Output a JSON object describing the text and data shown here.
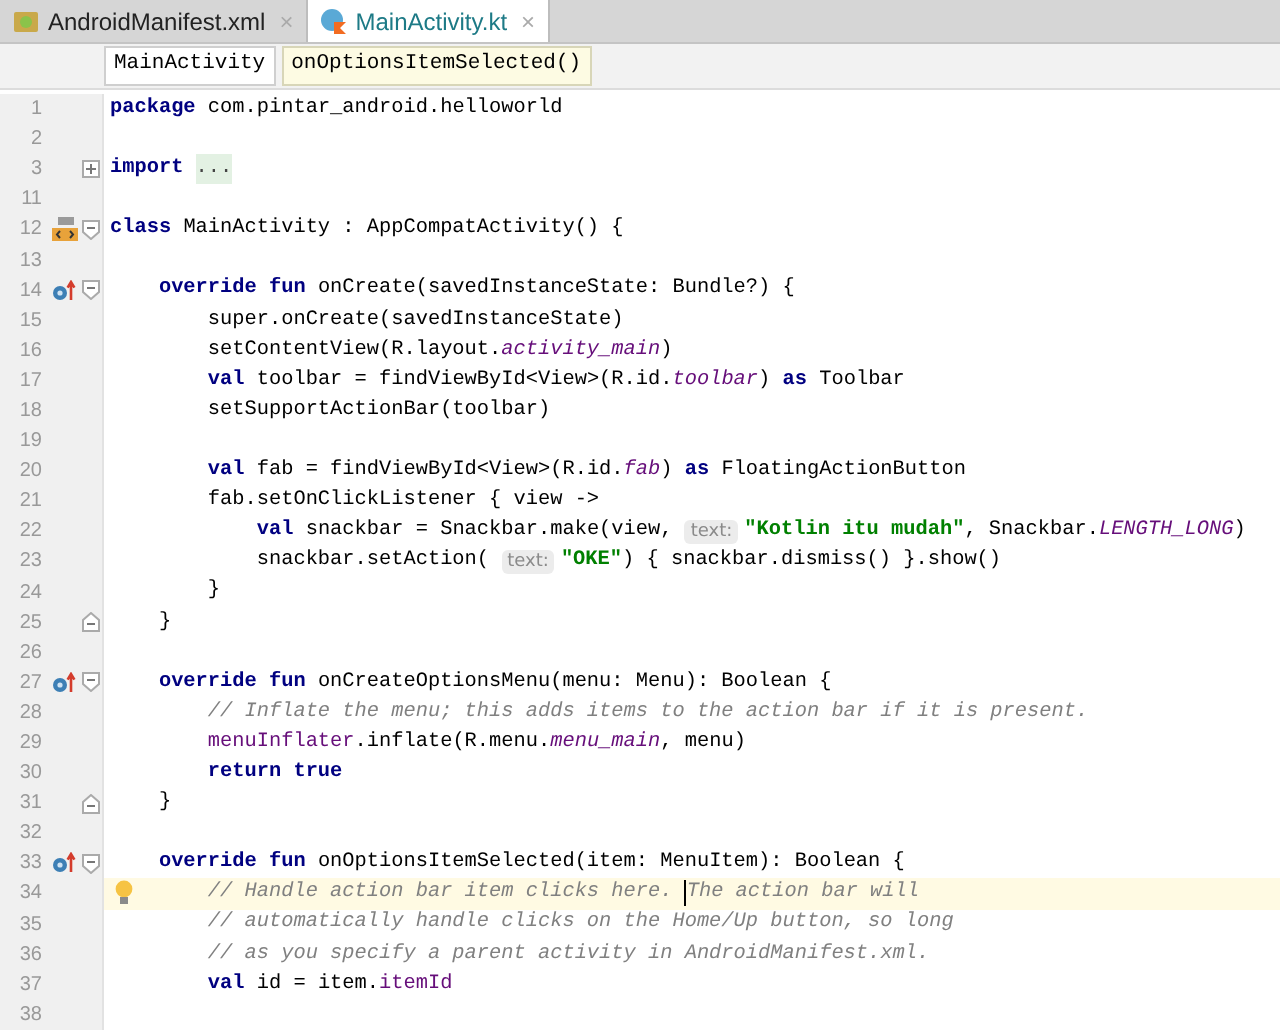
{
  "tabs": [
    {
      "label": "AndroidManifest.xml",
      "kind": "xml",
      "selected": false,
      "close": "×"
    },
    {
      "label": "MainActivity.kt",
      "kind": "kotlin",
      "selected": true,
      "close": "×"
    }
  ],
  "breadcrumbs": [
    {
      "label": "MainActivity",
      "selected": false
    },
    {
      "label": "onOptionsItemSelected()",
      "selected": true
    }
  ],
  "lines": [
    {
      "number": "1",
      "current": false,
      "tokens": [
        {
          "kind": "keyword",
          "text": "package "
        },
        {
          "kind": "plain",
          "text": "com.pintar_android.helloworld"
        }
      ]
    },
    {
      "number": "2",
      "current": false
    },
    {
      "number": "3",
      "current": false,
      "fold": {
        "kind": "collapsed"
      },
      "tokens": [
        {
          "kind": "keyword",
          "text": "import "
        },
        {
          "kind": "folded",
          "text": "..."
        }
      ]
    },
    {
      "number": "11",
      "current": false
    },
    {
      "number": "12",
      "current": false,
      "marker": {
        "kind": "class"
      },
      "fold": {
        "kind": "start"
      },
      "tokens": [
        {
          "kind": "keyword",
          "text": "class "
        },
        {
          "kind": "plain",
          "text": "MainActivity : AppCompatActivity() {"
        }
      ]
    },
    {
      "number": "13",
      "current": false
    },
    {
      "number": "14",
      "current": false,
      "marker": {
        "kind": "override"
      },
      "fold": {
        "kind": "start"
      },
      "tokens": [
        {
          "kind": "keyword",
          "text": "    override fun "
        },
        {
          "kind": "plain",
          "text": "onCreate(savedInstanceState: Bundle?) {"
        }
      ]
    },
    {
      "number": "15",
      "current": false,
      "tokens": [
        {
          "kind": "plain",
          "text": "        super.onCreate(savedInstanceState)"
        }
      ]
    },
    {
      "number": "16",
      "current": false,
      "tokens": [
        {
          "kind": "plain",
          "text": "        setContentView(R.layout."
        },
        {
          "kind": "property-italic",
          "text": "activity_main"
        },
        {
          "kind": "plain",
          "text": ")"
        }
      ]
    },
    {
      "number": "17",
      "current": false,
      "tokens": [
        {
          "kind": "keyword",
          "text": "        val "
        },
        {
          "kind": "plain",
          "text": "toolbar = findViewById<View>(R.id."
        },
        {
          "kind": "property-italic",
          "text": "toolbar"
        },
        {
          "kind": "plain",
          "text": ") "
        },
        {
          "kind": "keyword",
          "text": "as "
        },
        {
          "kind": "plain",
          "text": "Toolbar"
        }
      ]
    },
    {
      "number": "18",
      "current": false,
      "tokens": [
        {
          "kind": "plain",
          "text": "        setSupportActionBar(toolbar)"
        }
      ]
    },
    {
      "number": "19",
      "current": false
    },
    {
      "number": "20",
      "current": false,
      "tokens": [
        {
          "kind": "keyword",
          "text": "        val "
        },
        {
          "kind": "plain",
          "text": "fab = findViewById<View>(R.id."
        },
        {
          "kind": "property-italic",
          "text": "fab"
        },
        {
          "kind": "plain",
          "text": ") "
        },
        {
          "kind": "keyword",
          "text": "as "
        },
        {
          "kind": "plain",
          "text": "FloatingActionButton"
        }
      ]
    },
    {
      "number": "21",
      "current": false,
      "tokens": [
        {
          "kind": "plain",
          "text": "        fab.setOnClickListener { view ->"
        }
      ]
    },
    {
      "number": "22",
      "current": false,
      "tokens": [
        {
          "kind": "keyword",
          "text": "            val "
        },
        {
          "kind": "plain",
          "text": "snackbar = Snackbar.make(view, "
        },
        {
          "kind": "hint",
          "text": "text:"
        },
        {
          "kind": "string",
          "text": "\"Kotlin itu mudah\""
        },
        {
          "kind": "plain",
          "text": ", Snackbar."
        },
        {
          "kind": "property-italic",
          "text": "LENGTH_LONG"
        },
        {
          "kind": "plain",
          "text": ")"
        }
      ]
    },
    {
      "number": "23",
      "current": false,
      "tokens": [
        {
          "kind": "plain",
          "text": "            snackbar.setAction( "
        },
        {
          "kind": "hint",
          "text": "text:"
        },
        {
          "kind": "string",
          "text": "\"OKE\""
        },
        {
          "kind": "plain",
          "text": ") { snackbar.dismiss() }.show()"
        }
      ]
    },
    {
      "number": "24",
      "current": false,
      "tokens": [
        {
          "kind": "plain",
          "text": "        }"
        }
      ]
    },
    {
      "number": "25",
      "current": false,
      "fold": {
        "kind": "end"
      },
      "tokens": [
        {
          "kind": "plain",
          "text": "    }"
        }
      ]
    },
    {
      "number": "26",
      "current": false
    },
    {
      "number": "27",
      "current": false,
      "marker": {
        "kind": "override"
      },
      "fold": {
        "kind": "start"
      },
      "tokens": [
        {
          "kind": "keyword",
          "text": "    override fun "
        },
        {
          "kind": "plain",
          "text": "onCreateOptionsMenu(menu: Menu): Boolean {"
        }
      ]
    },
    {
      "number": "28",
      "current": false,
      "tokens": [
        {
          "kind": "comment",
          "text": "        // Inflate the menu; this adds items to the action bar if it is present."
        }
      ]
    },
    {
      "number": "29",
      "current": false,
      "tokens": [
        {
          "kind": "property",
          "text": "        menuInflater"
        },
        {
          "kind": "plain",
          "text": ".inflate(R.menu."
        },
        {
          "kind": "property-italic",
          "text": "menu_main"
        },
        {
          "kind": "plain",
          "text": ", menu)"
        }
      ]
    },
    {
      "number": "30",
      "current": false,
      "tokens": [
        {
          "kind": "keyword",
          "text": "        return true"
        }
      ]
    },
    {
      "number": "31",
      "current": false,
      "fold": {
        "kind": "end"
      },
      "tokens": [
        {
          "kind": "plain",
          "text": "    }"
        }
      ]
    },
    {
      "number": "32",
      "current": false
    },
    {
      "number": "33",
      "current": false,
      "marker": {
        "kind": "override"
      },
      "fold": {
        "kind": "start"
      },
      "tokens": [
        {
          "kind": "keyword",
          "text": "    override fun "
        },
        {
          "kind": "plain",
          "text": "onOptionsItemSelected(item: MenuItem): Boolean {"
        }
      ]
    },
    {
      "number": "34",
      "current": true,
      "tokens": [
        {
          "kind": "bulb"
        },
        {
          "kind": "comment",
          "text": "      // Handle action bar item clicks here. "
        },
        {
          "kind": "caret"
        },
        {
          "kind": "comment",
          "text": "The action bar will"
        }
      ]
    },
    {
      "number": "35",
      "current": false,
      "tokens": [
        {
          "kind": "comment",
          "text": "        // automatically handle clicks on the Home/Up button, so long"
        }
      ]
    },
    {
      "number": "36",
      "current": false,
      "tokens": [
        {
          "kind": "comment",
          "text": "        // as you specify a parent activity in AndroidManifest.xml."
        }
      ]
    },
    {
      "number": "37",
      "current": false,
      "tokens": [
        {
          "kind": "keyword",
          "text": "        val "
        },
        {
          "kind": "plain",
          "text": "id = item."
        },
        {
          "kind": "property",
          "text": "itemId"
        }
      ]
    },
    {
      "number": "38",
      "current": false
    }
  ]
}
